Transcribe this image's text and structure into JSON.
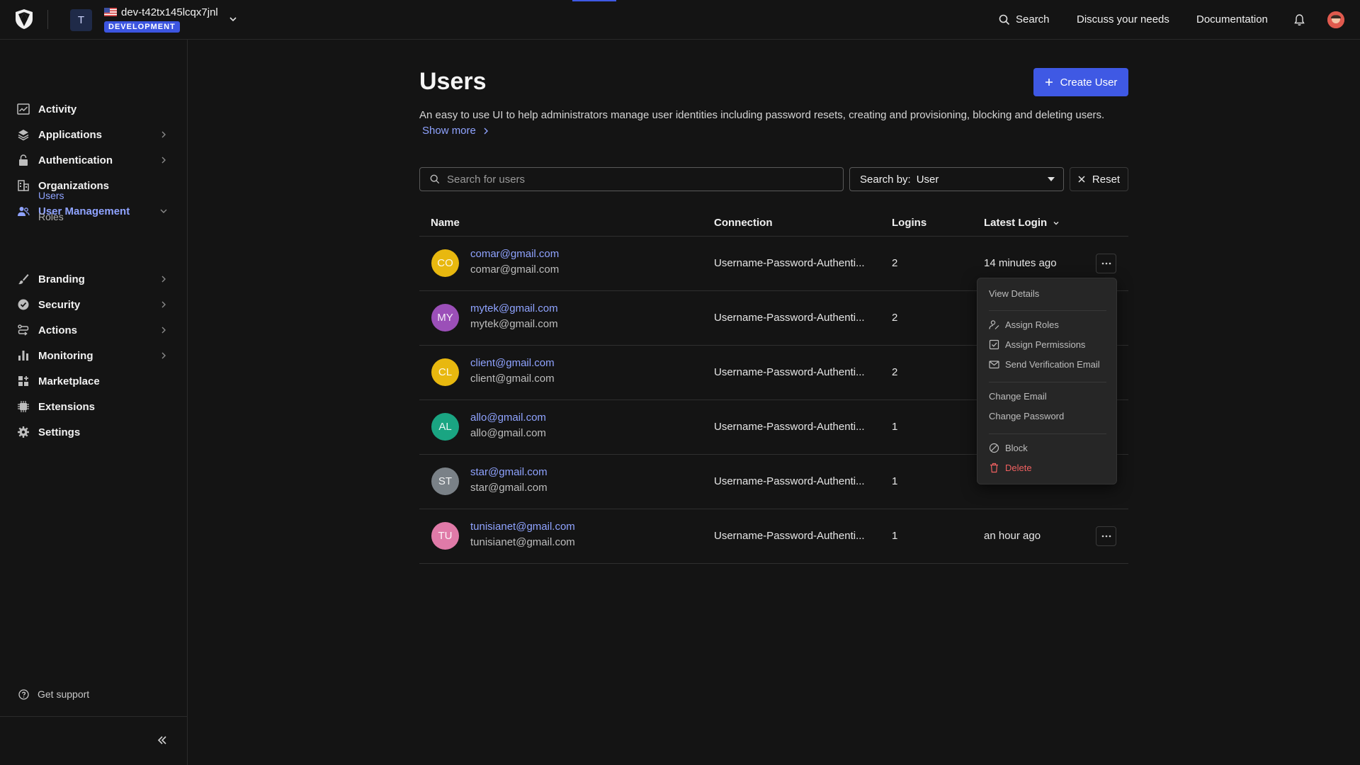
{
  "header": {
    "tenant_initial": "T",
    "tenant_name": "dev-t42tx145lcqx7jnl",
    "env_badge": "DEVELOPMENT",
    "search_label": "Search",
    "discuss_label": "Discuss your needs",
    "docs_label": "Documentation",
    "accent_color": "#3f59e4"
  },
  "sidebar": {
    "items": [
      {
        "label": "Activity",
        "icon": "activity-icon"
      },
      {
        "label": "Applications",
        "icon": "layers-icon"
      },
      {
        "label": "Authentication",
        "icon": "lock-icon"
      },
      {
        "label": "Organizations",
        "icon": "building-icon"
      },
      {
        "label": "User Management",
        "icon": "users-icon"
      },
      {
        "label": "Branding",
        "icon": "brush-icon"
      },
      {
        "label": "Security",
        "icon": "shield-check-icon"
      },
      {
        "label": "Actions",
        "icon": "actions-icon"
      },
      {
        "label": "Monitoring",
        "icon": "bar-chart-icon"
      },
      {
        "label": "Marketplace",
        "icon": "grid-plus-icon"
      },
      {
        "label": "Extensions",
        "icon": "chip-icon"
      },
      {
        "label": "Settings",
        "icon": "gear-icon"
      }
    ],
    "subitems": [
      {
        "label": "Users"
      },
      {
        "label": "Roles"
      }
    ],
    "support_label": "Get support"
  },
  "main": {
    "title": "Users",
    "create_label": "Create User",
    "description": "An easy to use UI to help administrators manage user identities including password resets, creating and provisioning, blocking and deleting users.",
    "show_more": "Show more",
    "search_placeholder": "Search for users",
    "search_by_label": "Search by:",
    "search_by_value": "User",
    "reset_label": "Reset",
    "columns": {
      "name": "Name",
      "connection": "Connection",
      "logins": "Logins",
      "latest_login": "Latest Login"
    },
    "rows": [
      {
        "initials": "CO",
        "color": "#e8b80f",
        "name": "comar@gmail.com",
        "email": "comar@gmail.com",
        "connection": "Username-Password-Authenti...",
        "logins": "2",
        "latest": "14 minutes ago"
      },
      {
        "initials": "MY",
        "color": "#9b4fb8",
        "name": "mytek@gmail.com",
        "email": "mytek@gmail.com",
        "connection": "Username-Password-Authenti...",
        "logins": "2",
        "latest": ""
      },
      {
        "initials": "CL",
        "color": "#e8b80f",
        "name": "client@gmail.com",
        "email": "client@gmail.com",
        "connection": "Username-Password-Authenti...",
        "logins": "2",
        "latest": ""
      },
      {
        "initials": "AL",
        "color": "#1aa582",
        "name": "allo@gmail.com",
        "email": "allo@gmail.com",
        "connection": "Username-Password-Authenti...",
        "logins": "1",
        "latest": ""
      },
      {
        "initials": "ST",
        "color": "#7a8187",
        "name": "star@gmail.com",
        "email": "star@gmail.com",
        "connection": "Username-Password-Authenti...",
        "logins": "1",
        "latest": ""
      },
      {
        "initials": "TU",
        "color": "#e07aa8",
        "name": "tunisianet@gmail.com",
        "email": "tunisianet@gmail.com",
        "connection": "Username-Password-Authenti...",
        "logins": "1",
        "latest": "an hour ago"
      }
    ]
  },
  "menu": {
    "view_details": "View Details",
    "assign_roles": "Assign Roles",
    "assign_permissions": "Assign Permissions",
    "send_verification": "Send Verification Email",
    "change_email": "Change Email",
    "change_password": "Change Password",
    "block": "Block",
    "delete": "Delete"
  }
}
